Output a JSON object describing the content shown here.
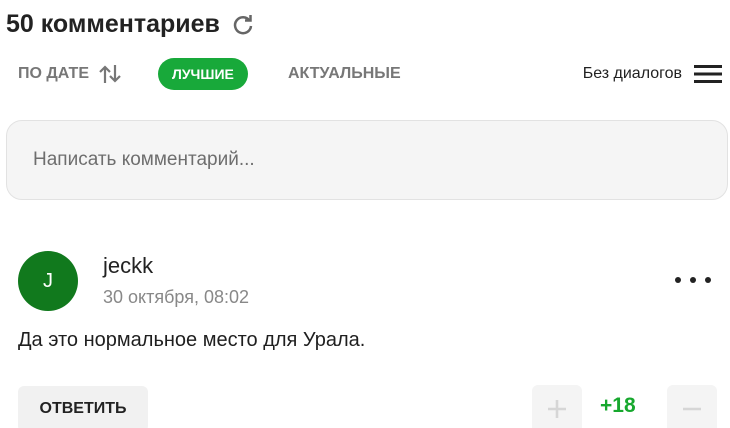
{
  "header": {
    "title": "50 комментариев",
    "refresh_icon": "refresh-icon"
  },
  "sort": {
    "by_date": "ПО ДАТЕ",
    "best": "ЛУЧШИЕ",
    "actual": "АКТУАЛЬНЫЕ",
    "dialogs": "Без диалогов",
    "active_color": "#18a93a",
    "icons": {
      "sort": "sort-arrows-icon",
      "menu": "hamburger-menu-icon"
    }
  },
  "input": {
    "placeholder": "Написать комментарий..."
  },
  "comment": {
    "avatar_initial": "J",
    "avatar_color": "#11791d",
    "author": "jeckk",
    "date": "30 октября, 08:02",
    "text": "Да это нормальное место для Урала.",
    "reply": "ОТВЕТИТЬ",
    "score": "+18",
    "score_color": "#17a82e",
    "icons": {
      "more": "more-dots-icon",
      "upvote": "plus-icon",
      "downvote": "minus-icon"
    }
  }
}
